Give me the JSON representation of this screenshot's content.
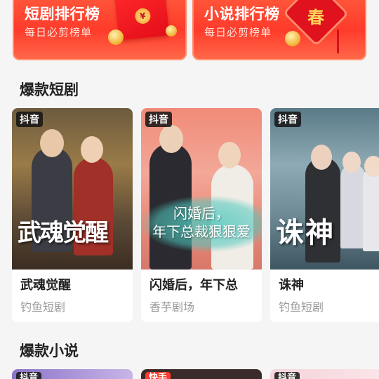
{
  "banners": [
    {
      "title": "短剧排行榜",
      "subtitle": "每日必剪榜单",
      "decor_icon": "red-envelope-icon",
      "seal_text": "¥"
    },
    {
      "title": "小说排行榜",
      "subtitle": "每日必剪榜单",
      "decor_icon": "chinese-knot-icon",
      "knot_text": "春"
    }
  ],
  "sections": {
    "drama": {
      "title": "爆款短剧",
      "cards": [
        {
          "platform": "抖音",
          "poster_text": "武魂觉醒",
          "name": "武魂觉醒",
          "source": "钓鱼短剧"
        },
        {
          "platform": "抖音",
          "poster_text": "闪婚后，\n年下总裁狠狠爱",
          "name": "闪婚后，年下总",
          "source": "香芋剧场"
        },
        {
          "platform": "抖音",
          "poster_text": "诛神",
          "name": "诛神",
          "source": "钓鱼短剧"
        }
      ]
    },
    "novel": {
      "title": "爆款小说",
      "cards": [
        {
          "platform": "抖音"
        },
        {
          "platform": "快手"
        },
        {
          "platform": "抖音"
        }
      ]
    }
  },
  "colors": {
    "banner_red": "#ff3b2b",
    "background": "#f5f5f5",
    "muted_text": "#999999"
  }
}
